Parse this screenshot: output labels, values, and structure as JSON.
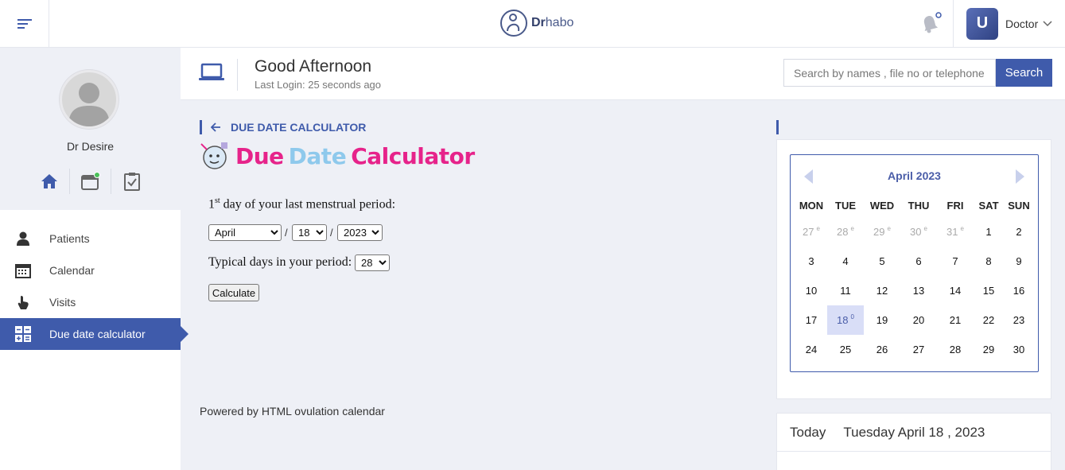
{
  "header": {
    "logo_text_bold": "Dr",
    "logo_text_rest": "habo",
    "user_initial": "U",
    "user_name": "Doctor"
  },
  "sidebar": {
    "doctor_name": "Dr Desire",
    "items": [
      {
        "label": "Patients",
        "icon": "patient-icon"
      },
      {
        "label": "Calendar",
        "icon": "calendar-icon"
      },
      {
        "label": "Visits",
        "icon": "hand-pointer-icon"
      },
      {
        "label": "Due date calculator",
        "icon": "calculator-icon",
        "active": true
      }
    ]
  },
  "greeting": {
    "title": "Good Afternoon",
    "subtitle": "Last Login: 25 seconds ago"
  },
  "search": {
    "placeholder": "Search by names , file no or telephone",
    "button_label": "Search"
  },
  "main": {
    "breadcrumb": "DUE DATE CALCULATOR",
    "title_words": [
      "Due",
      "Date",
      "Calculator"
    ],
    "title_colors": [
      "#e6238a",
      "#8ec9ec",
      "#e6238a"
    ],
    "lmp_ordinal": "1",
    "lmp_sup": "st",
    "lmp_label": " day of your last menstrual period:",
    "month_selected": "April",
    "day_selected": "18",
    "year_selected": "2023",
    "date_sep": "/",
    "period_label": "Typical days in your period:",
    "period_selected": "28",
    "calculate_label": "Calculate",
    "powered_by": "Powered by HTML ovulation calendar"
  },
  "calendar": {
    "month_label": "April  2023",
    "weekdays": [
      "MON",
      "TUE",
      "WED",
      "THU",
      "FRI",
      "SAT",
      "SUN"
    ],
    "weeks": [
      [
        {
          "d": "27",
          "sup": "e",
          "muted": true
        },
        {
          "d": "28",
          "sup": "e",
          "muted": true
        },
        {
          "d": "29",
          "sup": "e",
          "muted": true
        },
        {
          "d": "30",
          "sup": "e",
          "muted": true
        },
        {
          "d": "31",
          "sup": "e",
          "muted": true
        },
        {
          "d": "1"
        },
        {
          "d": "2"
        }
      ],
      [
        {
          "d": "3"
        },
        {
          "d": "4"
        },
        {
          "d": "5"
        },
        {
          "d": "6"
        },
        {
          "d": "7"
        },
        {
          "d": "8"
        },
        {
          "d": "9"
        }
      ],
      [
        {
          "d": "10"
        },
        {
          "d": "11"
        },
        {
          "d": "12"
        },
        {
          "d": "13"
        },
        {
          "d": "14"
        },
        {
          "d": "15"
        },
        {
          "d": "16"
        }
      ],
      [
        {
          "d": "17"
        },
        {
          "d": "18",
          "sup": "0",
          "today": true
        },
        {
          "d": "19"
        },
        {
          "d": "20"
        },
        {
          "d": "21"
        },
        {
          "d": "22"
        },
        {
          "d": "23"
        }
      ],
      [
        {
          "d": "24"
        },
        {
          "d": "25"
        },
        {
          "d": "26"
        },
        {
          "d": "27"
        },
        {
          "d": "28"
        },
        {
          "d": "29"
        },
        {
          "d": "30"
        }
      ]
    ]
  },
  "today": {
    "label": "Today",
    "date": "Tuesday April 18 , 2023"
  },
  "colors": {
    "primary": "#3f5bab",
    "today_bg": "#d9def7"
  }
}
